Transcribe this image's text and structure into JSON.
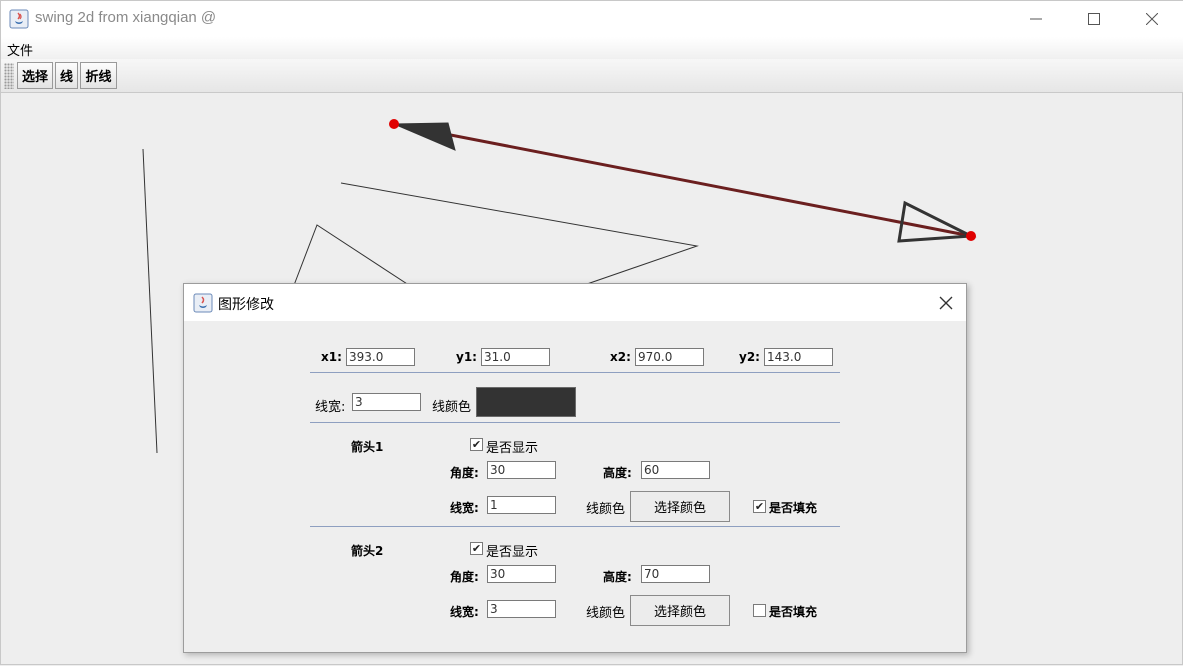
{
  "window": {
    "title": "swing 2d from xiangqian @"
  },
  "menu": {
    "file": "文件"
  },
  "toolbar": {
    "select": "选择",
    "line": "线",
    "polyline": "折线"
  },
  "canvas": {
    "endpoint_color": "#e00000",
    "line_color": "#6b1f1f",
    "shape_color": "#333333"
  },
  "dialog": {
    "title": "图形修改",
    "coords": {
      "x1_label": "x1:",
      "x1": "393.0",
      "y1_label": "y1:",
      "y1": "31.0",
      "x2_label": "x2:",
      "x2": "970.0",
      "y2_label": "y2:",
      "y2": "143.0"
    },
    "line": {
      "width_label": "线宽:",
      "width": "3",
      "color_label": "线颜色",
      "color": "#333333"
    },
    "arrow1": {
      "title": "箭头1",
      "show_label": "是否显示",
      "show": true,
      "angle_label": "角度:",
      "angle": "30",
      "height_label": "高度:",
      "height": "60",
      "width_label": "线宽:",
      "width": "1",
      "color_label": "线颜色",
      "color_button": "选择颜色",
      "fill_label": "是否填充",
      "fill": true
    },
    "arrow2": {
      "title": "箭头2",
      "show_label": "是否显示",
      "show": true,
      "angle_label": "角度:",
      "angle": "30",
      "height_label": "高度:",
      "height": "70",
      "width_label": "线宽:",
      "width": "3",
      "color_label": "线颜色",
      "color_button": "选择颜色",
      "fill_label": "是否填充",
      "fill": false
    }
  }
}
